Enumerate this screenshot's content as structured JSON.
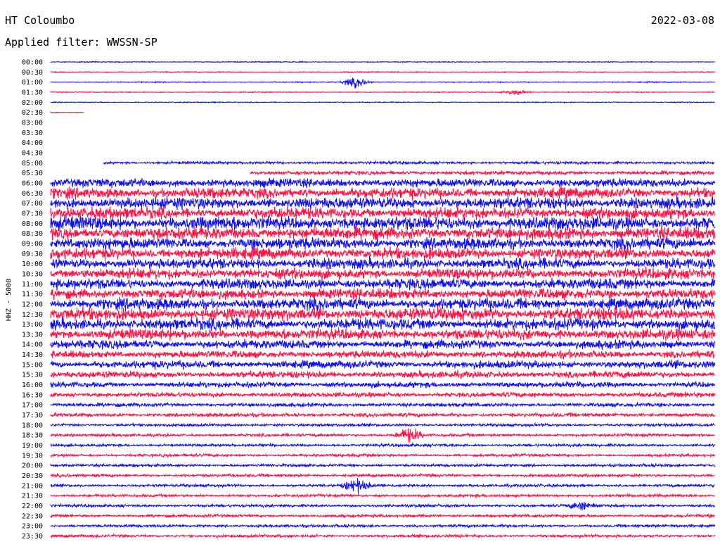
{
  "station": "HT Coloumbo",
  "date": "2022-03-08",
  "filter_label": "Applied filter: WWSSN-SP",
  "channel_label": "HHZ - 5000",
  "colors": {
    "trace_even": "#1010ee",
    "trace_odd": "#ff1144",
    "background": "#ffffff",
    "text": "#000000"
  },
  "chart_data": {
    "type": "line",
    "description_type": "helicorder",
    "rows": [
      "00:00",
      "00:30",
      "01:00",
      "01:30",
      "02:00",
      "02:30",
      "03:00",
      "03:30",
      "04:00",
      "04:30",
      "05:00",
      "05:30",
      "06:00",
      "06:30",
      "07:00",
      "07:30",
      "08:00",
      "08:30",
      "09:00",
      "09:30",
      "10:00",
      "10:30",
      "11:00",
      "11:30",
      "12:00",
      "12:30",
      "13:00",
      "13:30",
      "14:00",
      "14:30",
      "15:00",
      "15:30",
      "16:00",
      "16:30",
      "17:00",
      "17:30",
      "18:00",
      "18:30",
      "19:00",
      "19:30",
      "20:00",
      "20:30",
      "21:00",
      "21:30",
      "22:00",
      "22:30",
      "23:00",
      "23:30"
    ],
    "row_amplitude": [
      1,
      1,
      1,
      1,
      1,
      1,
      0,
      0,
      0,
      0,
      3,
      4,
      9,
      11,
      12,
      12,
      14,
      13,
      12,
      12,
      11,
      11,
      11,
      11,
      12,
      13,
      12,
      11,
      9,
      8,
      8,
      7,
      6,
      5,
      4,
      4,
      3,
      3,
      3,
      3,
      3,
      3,
      3,
      3,
      3,
      3,
      3,
      3
    ],
    "row_coverage": [
      [
        0,
        1
      ],
      [
        0,
        1
      ],
      [
        0,
        1
      ],
      [
        0,
        1
      ],
      [
        0,
        1
      ],
      [
        0,
        0.05
      ],
      [
        0,
        0
      ],
      [
        0,
        0
      ],
      [
        0,
        0
      ],
      [
        0,
        0
      ],
      [
        0.08,
        1
      ],
      [
        0.3,
        1
      ],
      [
        0,
        1
      ],
      [
        0,
        1
      ],
      [
        0,
        1
      ],
      [
        0,
        1
      ],
      [
        0,
        1
      ],
      [
        0,
        1
      ],
      [
        0,
        1
      ],
      [
        0,
        1
      ],
      [
        0,
        1
      ],
      [
        0,
        1
      ],
      [
        0,
        1
      ],
      [
        0,
        1
      ],
      [
        0,
        1
      ],
      [
        0,
        1
      ],
      [
        0,
        1
      ],
      [
        0,
        1
      ],
      [
        0,
        1
      ],
      [
        0,
        1
      ],
      [
        0,
        1
      ],
      [
        0,
        1
      ],
      [
        0,
        1
      ],
      [
        0,
        1
      ],
      [
        0,
        1
      ],
      [
        0,
        1
      ],
      [
        0,
        1
      ],
      [
        0,
        1
      ],
      [
        0,
        1
      ],
      [
        0,
        1
      ],
      [
        0,
        1
      ],
      [
        0,
        1
      ],
      [
        0,
        1
      ],
      [
        0,
        1
      ],
      [
        0,
        1
      ],
      [
        0,
        1
      ],
      [
        0,
        1
      ],
      [
        0,
        1
      ]
    ],
    "events": [
      {
        "row": "01:00",
        "position": 0.46,
        "amplitude": 10
      },
      {
        "row": "01:30",
        "position": 0.7,
        "amplitude": 5
      },
      {
        "row": "18:30",
        "position": 0.54,
        "amplitude": 14
      },
      {
        "row": "21:00",
        "position": 0.46,
        "amplitude": 12
      },
      {
        "row": "22:00",
        "position": 0.8,
        "amplitude": 8
      }
    ],
    "x_span_minutes": 30
  }
}
